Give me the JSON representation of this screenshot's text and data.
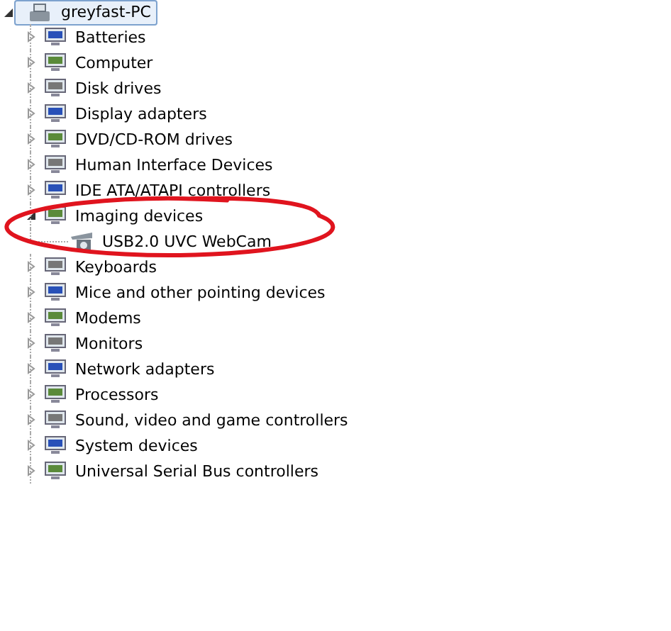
{
  "tree": {
    "label": "greyfast-PC",
    "selected": true,
    "expanded": true,
    "children": [
      {
        "label": "Batteries",
        "expanded": false,
        "selected": false
      },
      {
        "label": "Computer",
        "expanded": false,
        "selected": false
      },
      {
        "label": "Disk drives",
        "expanded": false,
        "selected": false
      },
      {
        "label": "Display adapters",
        "expanded": false,
        "selected": false
      },
      {
        "label": "DVD/CD-ROM drives",
        "expanded": false,
        "selected": false
      },
      {
        "label": "Human Interface Devices",
        "expanded": false,
        "selected": false
      },
      {
        "label": "IDE ATA/ATAPI controllers",
        "expanded": false,
        "selected": false
      },
      {
        "label": "Imaging devices",
        "expanded": true,
        "selected": false,
        "children": [
          {
            "label": "USB2.0 UVC WebCam",
            "selected": false
          }
        ]
      },
      {
        "label": "Keyboards",
        "expanded": false,
        "selected": false
      },
      {
        "label": "Mice and other pointing devices",
        "expanded": false,
        "selected": false
      },
      {
        "label": "Modems",
        "expanded": false,
        "selected": false
      },
      {
        "label": "Monitors",
        "expanded": false,
        "selected": false
      },
      {
        "label": "Network adapters",
        "expanded": false,
        "selected": false
      },
      {
        "label": "Processors",
        "expanded": false,
        "selected": false
      },
      {
        "label": "Sound, video and game controllers",
        "expanded": false,
        "selected": false
      },
      {
        "label": "System devices",
        "expanded": false,
        "selected": false
      },
      {
        "label": "Universal Serial Bus controllers",
        "expanded": false,
        "selected": false
      }
    ]
  },
  "annotation": {
    "kind": "ellipse",
    "color": "#e0141e"
  }
}
